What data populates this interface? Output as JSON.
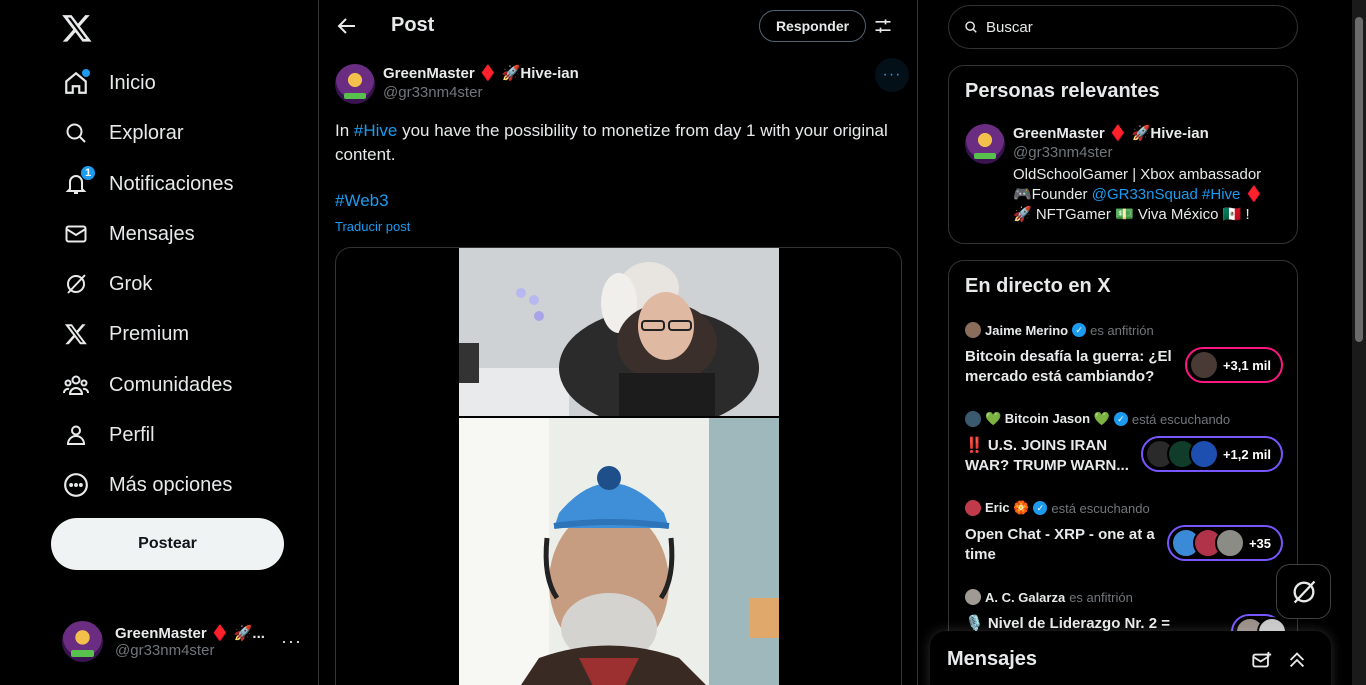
{
  "sidebar": {
    "items": [
      {
        "label": "Inicio",
        "icon": "home-icon"
      },
      {
        "label": "Explorar",
        "icon": "search-icon"
      },
      {
        "label": "Notificaciones",
        "icon": "bell-icon",
        "badge": "1"
      },
      {
        "label": "Mensajes",
        "icon": "mail-icon"
      },
      {
        "label": "Grok",
        "icon": "grok-icon"
      },
      {
        "label": "Premium",
        "icon": "x-icon"
      },
      {
        "label": "Comunidades",
        "icon": "people-icon"
      },
      {
        "label": "Perfil",
        "icon": "user-icon"
      },
      {
        "label": "Más opciones",
        "icon": "more-circle-icon"
      }
    ],
    "post_button": "Postear",
    "account": {
      "name": "GreenMaster ♦️ 🚀...",
      "handle": "@gr33nm4ster"
    }
  },
  "header": {
    "title": "Post",
    "reply_button": "Responder"
  },
  "post": {
    "author_name": "GreenMaster ♦️ 🚀Hive-ian",
    "author_handle": "@gr33nm4ster",
    "text_before": "In ",
    "link": "#Hive",
    "text_after": " you have the possibility to monetize from day 1 with your original content.",
    "hashtag": "#Web3",
    "translate": "Traducir post"
  },
  "search": {
    "placeholder": "Buscar"
  },
  "relevant": {
    "title": "Personas relevantes",
    "name": "GreenMaster ♦️ 🚀Hive-ian",
    "handle": "@gr33nm4ster",
    "bio_1": "OldSchoolGamer | Xbox ambassador",
    "bio_2a": "🎮Founder ",
    "bio_2b": "@GR33nSquad",
    "bio_2c": " ",
    "bio_2d": "#Hive",
    "bio_2e": " ♦️",
    "bio_3": "🚀 NFTGamer 💵 Viva México 🇲🇽 !"
  },
  "live": {
    "title": "En directo en X",
    "spaces": [
      {
        "host": "Jaime Merino",
        "role": "es anfitrión",
        "title": "Bitcoin desafía la guerra: ¿El mercado está cambiando?",
        "count": "+3,1 mil",
        "color": "#f91880"
      },
      {
        "host": "💚 Bitcoin Jason 💚",
        "role": "está escuchando",
        "title": "‼️ U.S. JOINS IRAN WAR? TRUMP WARN...",
        "count": "+1,2 mil",
        "color": "#7856ff"
      },
      {
        "host": "Eric 🏵️",
        "role": "está escuchando",
        "title": "Open Chat - XRP - one at a time",
        "count": "+35",
        "color": "#7856ff"
      },
      {
        "host": "A. C. Galarza",
        "role": "es anfitrión",
        "title": "🎙️ Nivel de Liderazgo Nr. 2  =",
        "count": "",
        "color": "#7856ff"
      }
    ]
  },
  "messages_drawer": {
    "title": "Mensajes"
  },
  "colors": {
    "accent": "#1d9bf0",
    "background": "#000000",
    "border": "#2f3336",
    "muted": "#71767b"
  }
}
